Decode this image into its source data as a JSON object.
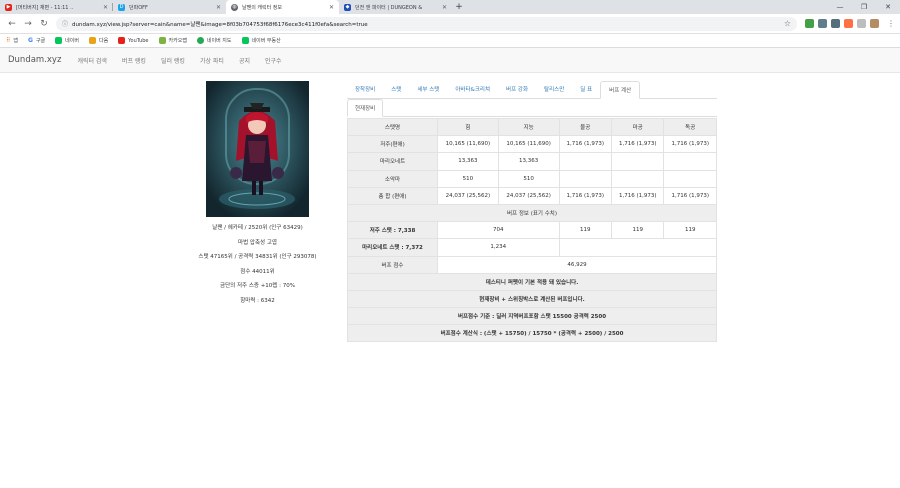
{
  "browser": {
    "tabs": [
      {
        "title": "[머티버지] 재편 - 11:11 ..",
        "fav_color": "#e62117",
        "active": false
      },
      {
        "title": "던파OFF",
        "fav_color": "#1aa3e8",
        "fav_letter": "D",
        "active": false
      },
      {
        "title": "날짼의 캐릭터 정보",
        "fav_color": "#5f6368",
        "active": true
      },
      {
        "title": "던전 앤 파이터 | DUNGEON &",
        "fav_color": "#1d4fb8",
        "active": false
      }
    ],
    "url": "dundam.xyz/view.jsp?server=cain&name=날짼&image=8f03b704753f68f6176ece3c411f0efa&search=true",
    "bookmarks": [
      {
        "label": "앱",
        "color": "#5f6368"
      },
      {
        "label": "구글",
        "color": "#4285f4"
      },
      {
        "label": "네이버",
        "color": "#03c75a"
      },
      {
        "label": "다음",
        "color": "#e8a317"
      },
      {
        "label": "YouTube",
        "color": "#e62117"
      },
      {
        "label": "카카오맵",
        "color": "#7cb342"
      },
      {
        "label": "네이버 지도",
        "color": "#22aa55"
      },
      {
        "label": "네이버 부동산",
        "color": "#03c75a"
      }
    ]
  },
  "site": {
    "brand": "Dundam.xyz",
    "nav": [
      "캐릭터 검색",
      "버프 랭킹",
      "딜러 랭킹",
      "가상 파티",
      "공지",
      "인구수"
    ]
  },
  "character": {
    "line1": "날짼 / 헤카테 / 2520위 (인구 63429)",
    "line2": "마법 압축성 고엽",
    "line3": "스탯 47165위 / 공격력 34831위 (인구 293078)",
    "line4": "점수 44011위",
    "line5": "금단의 저주 스증 +10렙 : 70%",
    "line6": "항마력 : 6342"
  },
  "tabs": [
    "장착장비",
    "스탯",
    "세부 스탯",
    "아바타&크리쳐",
    "버프 강화",
    "탈리스만",
    "딜 표",
    "버프 계산"
  ],
  "active_tab": "버프 계산",
  "subtab": "현재장비",
  "table": {
    "header": [
      "스탯명",
      "힘",
      "지능",
      "물공",
      "마공",
      "독공"
    ],
    "rows": [
      [
        "저주(편애)",
        "10,165 (11,690)",
        "10,165 (11,690)",
        "1,716 (1,973)",
        "1,716 (1,973)",
        "1,716 (1,973)"
      ],
      [
        "마리오네트",
        "13,363",
        "13,363",
        "",
        "",
        ""
      ],
      [
        "소악마",
        "510",
        "510",
        "",
        "",
        ""
      ],
      [
        "총 합 (편애)",
        "24,037 (25,562)",
        "24,037 (25,562)",
        "1,716 (1,973)",
        "1,716 (1,973)",
        "1,716 (1,973)"
      ]
    ],
    "buff_info_title": "버프 정보 (표기 수치)",
    "curse_label": "저주 스탯 : 7,338",
    "curse_vals": [
      "704",
      "119",
      "119",
      "119"
    ],
    "mario_label": "마리오네트 스탯 : 7,372",
    "mario_val": "1,234",
    "score_label": "버프 점수",
    "score_val": "46,929",
    "notes": [
      "데스티니 퍼펫이 기본 적용 돼 있습니다.",
      "현재장비 + 스위칭박스로 계산된 버프입니다.",
      "버프점수 기준 : 딜러 지역버프포함 스탯 15500 공격력 2500",
      "버프점수 계산식 : (스탯 + 15750) / 15750 * (공격력 + 2500) / 2500"
    ]
  }
}
